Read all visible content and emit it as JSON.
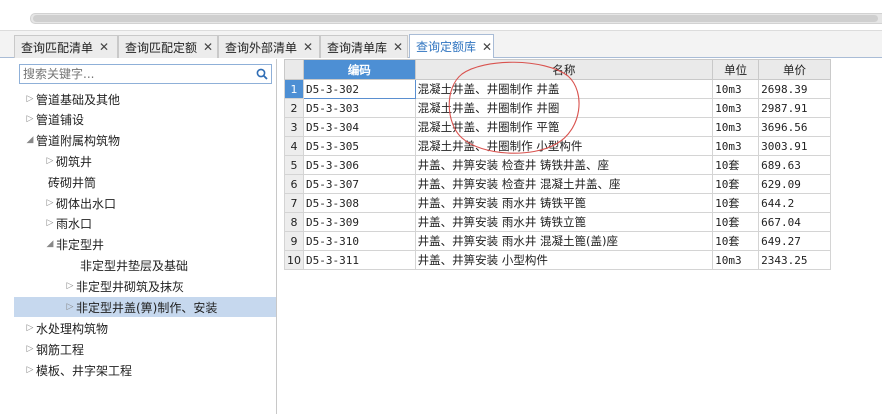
{
  "tabs": [
    {
      "label": "查询匹配清单",
      "active": false
    },
    {
      "label": "查询匹配定额",
      "active": false
    },
    {
      "label": "查询外部清单",
      "active": false
    },
    {
      "label": "查询清单库",
      "active": false
    },
    {
      "label": "查询定额库",
      "active": true
    }
  ],
  "search": {
    "placeholder": "搜索关键字..."
  },
  "tree": [
    {
      "label": "管道基础及其他",
      "arrow": "▷",
      "depth": 0
    },
    {
      "label": "管道铺设",
      "arrow": "▷",
      "depth": 0
    },
    {
      "label": "管道附属构筑物",
      "arrow": "◢",
      "depth": 0
    },
    {
      "label": "砌筑井",
      "arrow": "▷",
      "depth": 1
    },
    {
      "label": "砖砌井筒",
      "arrow": "",
      "depth": 1
    },
    {
      "label": "砌体出水口",
      "arrow": "▷",
      "depth": 1
    },
    {
      "label": "雨水口",
      "arrow": "▷",
      "depth": 1
    },
    {
      "label": "非定型井",
      "arrow": "◢",
      "depth": 1
    },
    {
      "label": "非定型井垫层及基础",
      "arrow": "",
      "depth": 2
    },
    {
      "label": "非定型井砌筑及抹灰",
      "arrow": "▷",
      "depth": 2
    },
    {
      "label": "非定型井盖(箅)制作、安装",
      "arrow": "▷",
      "depth": 2,
      "selected": true
    },
    {
      "label": "水处理构筑物",
      "arrow": "▷",
      "depth": 0
    },
    {
      "label": "钢筋工程",
      "arrow": "▷",
      "depth": 0
    },
    {
      "label": "模板、井字架工程",
      "arrow": "▷",
      "depth": 0
    }
  ],
  "grid": {
    "headers": {
      "code": "编码",
      "name": "名称",
      "unit": "单位",
      "price": "单价"
    },
    "rows": [
      {
        "num": "1",
        "code": "D5-3-302",
        "name": "混凝土井盖、井圈制作 井盖",
        "unit": "10m3",
        "price": "2698.39"
      },
      {
        "num": "2",
        "code": "D5-3-303",
        "name": "混凝土井盖、井圈制作 井圈",
        "unit": "10m3",
        "price": "2987.91"
      },
      {
        "num": "3",
        "code": "D5-3-304",
        "name": "混凝土井盖、井圈制作 平篦",
        "unit": "10m3",
        "price": "3696.56"
      },
      {
        "num": "4",
        "code": "D5-3-305",
        "name": "混凝土井盖、井圈制作 小型构件",
        "unit": "10m3",
        "price": "3003.91"
      },
      {
        "num": "5",
        "code": "D5-3-306",
        "name": "井盖、井箅安装 检查井 铸铁井盖、座",
        "unit": "10套",
        "price": "689.63"
      },
      {
        "num": "6",
        "code": "D5-3-307",
        "name": "井盖、井箅安装 检查井 混凝土井盖、座",
        "unit": "10套",
        "price": "629.09"
      },
      {
        "num": "7",
        "code": "D5-3-308",
        "name": "井盖、井箅安装 雨水井 铸铁平篦",
        "unit": "10套",
        "price": "644.2"
      },
      {
        "num": "8",
        "code": "D5-3-309",
        "name": "井盖、井箅安装 雨水井 铸铁立篦",
        "unit": "10套",
        "price": "667.04"
      },
      {
        "num": "9",
        "code": "D5-3-310",
        "name": "井盖、井箅安装 雨水井 混凝土篦(盖)座",
        "unit": "10套",
        "price": "649.27"
      },
      {
        "num": "10",
        "code": "D5-3-311",
        "name": "井盖、井箅安装 小型构件",
        "unit": "10m3",
        "price": "2343.25"
      }
    ]
  },
  "colors": {
    "accent": "#4d8fd4",
    "tab_active_text": "#2f74c0",
    "annotation": "#d9534f",
    "selected_row": "#c6d8ee"
  }
}
